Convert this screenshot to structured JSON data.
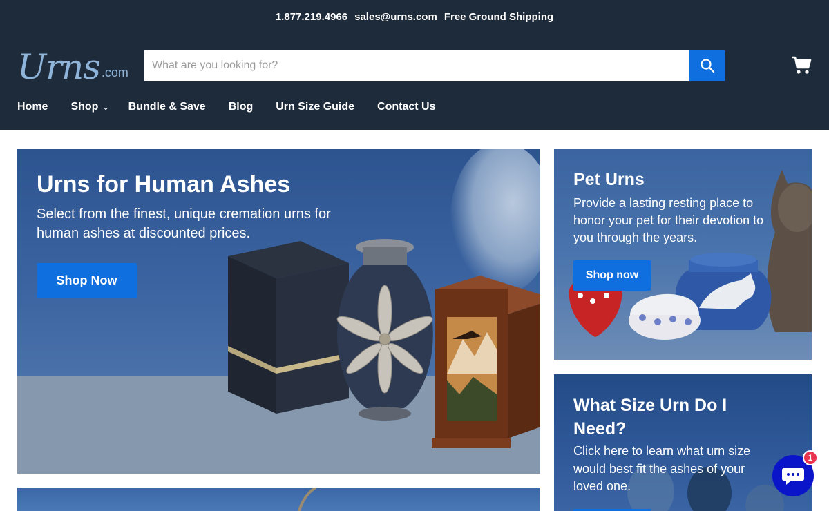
{
  "topbar": {
    "phone": "1.877.219.4966",
    "email": "sales@urns.com",
    "shipping": "Free Ground Shipping"
  },
  "header": {
    "logo_main": "Urns",
    "logo_suffix": ".com",
    "search_placeholder": "What are you looking for?",
    "search_icon": "search-icon",
    "cart_icon": "cart-icon"
  },
  "nav": {
    "items": [
      {
        "label": "Home"
      },
      {
        "label": "Shop",
        "has_dropdown": true
      },
      {
        "label": "Bundle & Save"
      },
      {
        "label": "Blog"
      },
      {
        "label": "Urn Size Guide"
      },
      {
        "label": "Contact Us"
      }
    ]
  },
  "hero": {
    "title": "Urns for Human Ashes",
    "description": "Select from the finest, unique cremation urns for human ashes at discounted prices.",
    "button": "Shop Now"
  },
  "pet": {
    "title": "Pet Urns",
    "description": "Provide a lasting resting place to honor your pet for their devotion to you through the years.",
    "button": "Shop now"
  },
  "size_guide": {
    "title": "What Size Urn Do I Need?",
    "description": "Click here to learn what urn size would best fit the ashes of your loved one."
  },
  "chat": {
    "icon": "chat-icon",
    "badge_count": "1"
  },
  "colors": {
    "header_bg": "#1e2b3b",
    "accent": "#0f6fde",
    "badge": "#e8344e",
    "chat": "#0a14c8"
  }
}
